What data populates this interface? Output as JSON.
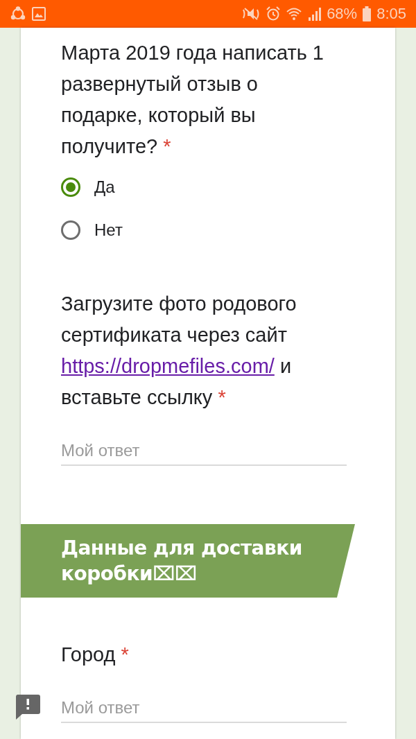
{
  "status_bar": {
    "battery": "68%",
    "time": "8:05"
  },
  "items": [
    {
      "kind": "radio",
      "title": "Марта 2019 года написать 1 развернутый отзыв о подарке, который вы получите?",
      "required_mark": "*",
      "options": [
        {
          "label": "Да",
          "selected": true
        },
        {
          "label": "Нет",
          "selected": false
        }
      ]
    },
    {
      "kind": "text",
      "title": "Загрузите фото родового сертификата через сайт",
      "link": "https://dropmefiles.com/",
      "title_after": "и вставьте ссылку",
      "required_mark": "*",
      "placeholder": "Мой ответ"
    },
    {
      "kind": "section",
      "title": "Данные для доставки коробки⌧⌧"
    },
    {
      "kind": "text",
      "title": "Город",
      "required_mark": "*",
      "placeholder": "Мой ответ"
    }
  ]
}
